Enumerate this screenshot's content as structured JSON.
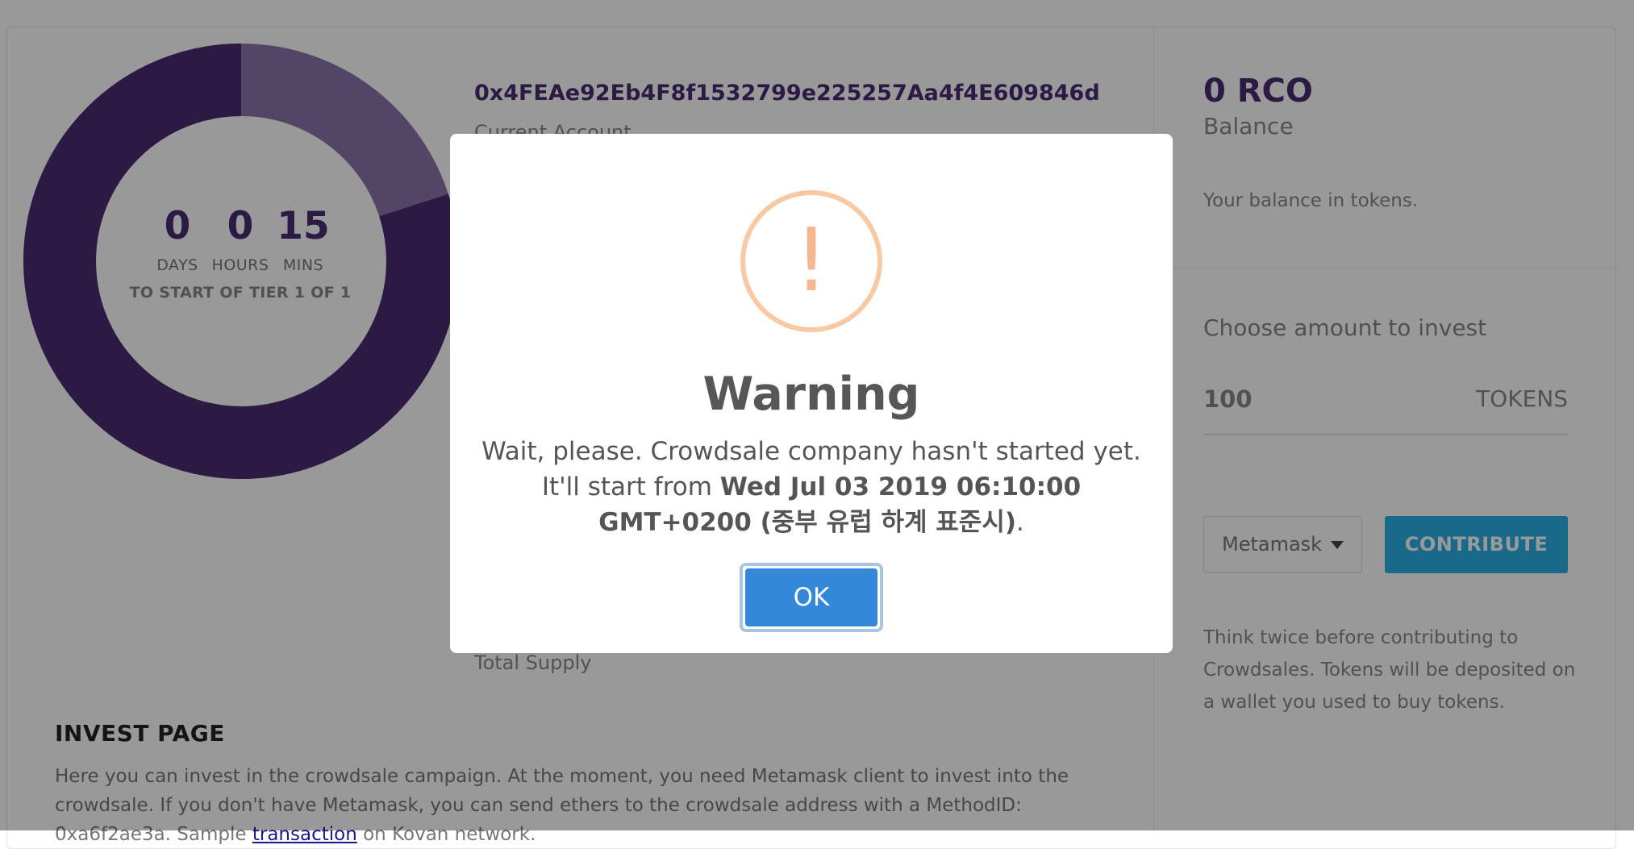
{
  "timer": {
    "days": "0",
    "days_label": "DAYS",
    "hours": "0",
    "hours_label": "HOURS",
    "mins": "15",
    "mins_label": "MINS",
    "tier_text": "TO START OF TIER 1 OF 1",
    "progress_elapsed_fraction": 0.8,
    "colors": {
      "main": "#4a2b72",
      "remaining": "#8b73a8"
    }
  },
  "account": {
    "address": "0x4FEAe92Eb4F8f1532799e225257Aa4f4E609846d",
    "label": "Current Account"
  },
  "supply": {
    "label": "Total Supply"
  },
  "invest": {
    "title": "INVEST PAGE",
    "text_part1": "Here you can invest in the crowdsale campaign. At the moment, you need Metamask client to invest into the crowdsale. If you don't have Metamask, you can send ethers to the crowdsale address with a MethodID: 0xa6f2ae3a. Sample ",
    "link_text": "transaction",
    "text_part2": " on Kovan network."
  },
  "balance": {
    "value": "0 RCO",
    "label": "Balance",
    "description": "Your balance in tokens."
  },
  "contribute": {
    "choose_label": "Choose amount to invest",
    "amount_value": "100",
    "amount_unit": "TOKENS",
    "wallet_selected": "Metamask",
    "button_label": "CONTRIBUTE",
    "note": "Think twice before contributing to Crowdsales. Tokens will be deposited on a wallet you used to buy tokens.",
    "accent_color": "#2bb0e6"
  },
  "modal": {
    "icon": "exclamation-icon",
    "icon_glyph": "!",
    "title": "Warning",
    "text_part1": "Wait, please. Crowdsale company hasn't started yet. It'll start from ",
    "text_bold": "Wed Jul 03 2019 06:10:00 GMT+0200 (중부 유럽 하계 표준시)",
    "text_part2": ".",
    "ok_label": "OK",
    "ok_color": "#3487d9"
  }
}
